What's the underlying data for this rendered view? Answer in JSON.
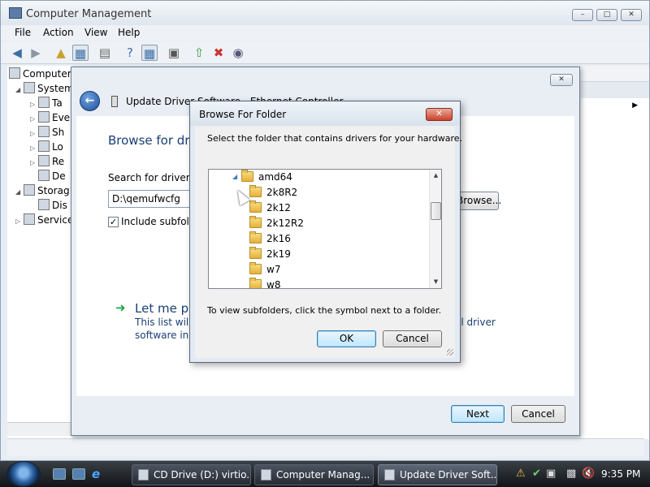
{
  "main_window": {
    "title": "Computer Management",
    "menu": [
      "File",
      "Action",
      "View",
      "Help"
    ],
    "tree": [
      {
        "label": "Computer",
        "level": 0
      },
      {
        "label": "System",
        "level": 1
      },
      {
        "label": "Ta",
        "level": 2
      },
      {
        "label": "Eve",
        "level": 2
      },
      {
        "label": "Sh",
        "level": 2
      },
      {
        "label": "Lo",
        "level": 2
      },
      {
        "label": "Re",
        "level": 2
      },
      {
        "label": "De",
        "level": 2
      },
      {
        "label": "Storag",
        "level": 1
      },
      {
        "label": "Dis",
        "level": 2
      },
      {
        "label": "Service",
        "level": 1
      }
    ]
  },
  "update_driver": {
    "title": "Update Driver Software - Ethernet Controller",
    "heading": "Browse for driver software on your computer",
    "search_label": "Search for driver software in this location:",
    "path_value": "D:\\qemufwcfg",
    "browse_label": "Browse...",
    "include_subfolders": "Include subfolders",
    "include_checked": true,
    "let_me_pick": "Let me pick from a list of device drivers on my computer",
    "desc_line1": "This list will show installed driver software compatible with the device, and a",
    "desc_line1_tail": "ll driver",
    "desc_line2": "software in the same category as the device.",
    "next_label": "Next",
    "cancel_label": "Cancel"
  },
  "browse_folder": {
    "title": "Browse For Folder",
    "instruction": "Select the folder that contains drivers for your hardware.",
    "tree": [
      {
        "label": "amd64",
        "expanded": true
      },
      {
        "label": "2k8R2"
      },
      {
        "label": "2k12"
      },
      {
        "label": "2k12R2"
      },
      {
        "label": "2k16"
      },
      {
        "label": "2k19"
      },
      {
        "label": "w7"
      },
      {
        "label": "w8"
      }
    ],
    "hint": "To view subfolders, click the symbol next to a folder.",
    "ok_label": "OK",
    "cancel_label": "Cancel"
  },
  "taskbar": {
    "tasks": [
      {
        "label": "CD Drive (D:) virtio..."
      },
      {
        "label": "Computer Manag..."
      },
      {
        "label": "Update Driver Soft..."
      }
    ],
    "clock": "9:35 PM"
  }
}
